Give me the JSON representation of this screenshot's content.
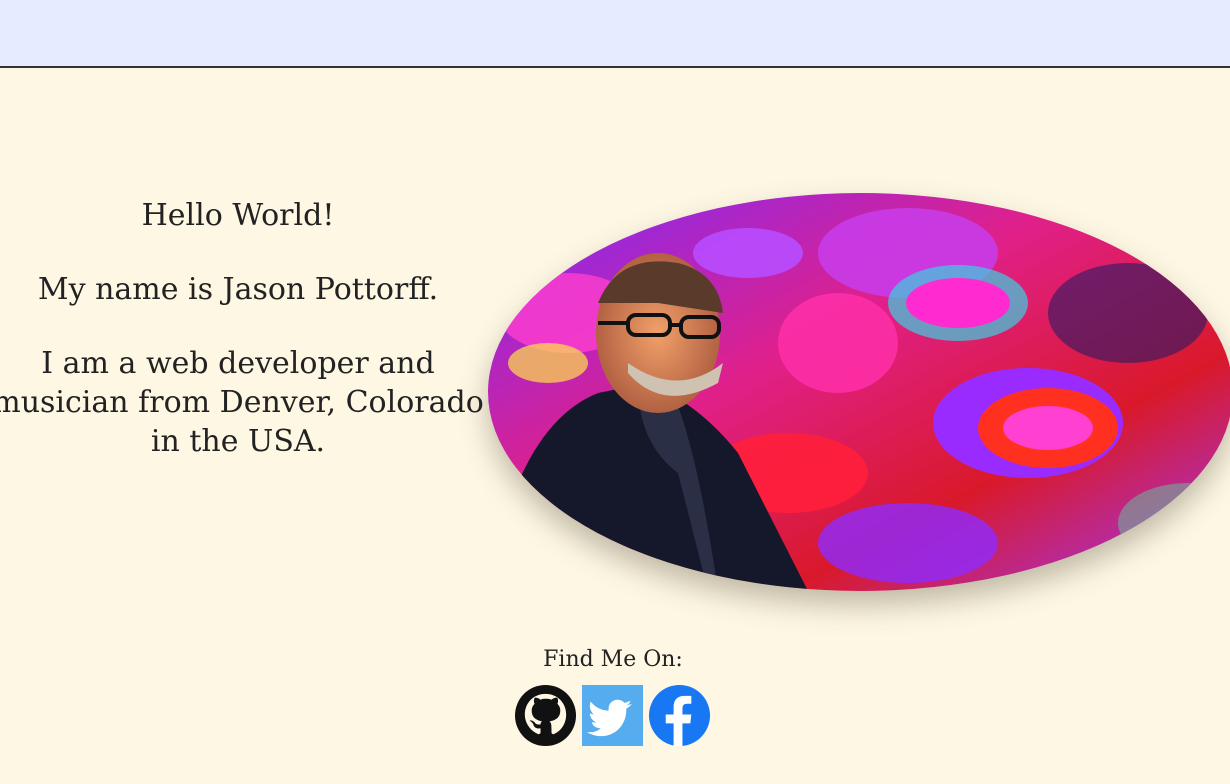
{
  "intro": {
    "greeting": "Hello World!",
    "name_line": "My name is Jason Pottorff.",
    "bio": "I am a web developer and musician from Denver, Colorado in the USA."
  },
  "portrait": {
    "alt_icon": "portrait-photo"
  },
  "social": {
    "heading": "Find Me On:",
    "links": [
      {
        "icon": "github-icon",
        "color": "#111111"
      },
      {
        "icon": "twitter-icon",
        "color": "#55acee"
      },
      {
        "icon": "facebook-icon",
        "color": "#1877f2"
      }
    ]
  },
  "colors": {
    "background": "#fdf7e4",
    "topbar": "#e6ebff",
    "text": "#222222"
  }
}
